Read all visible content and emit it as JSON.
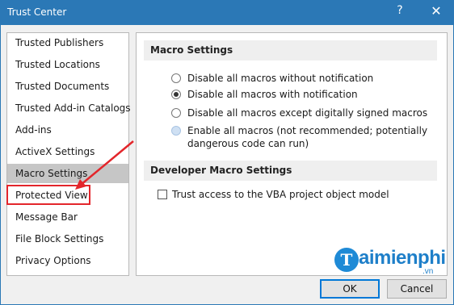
{
  "window": {
    "title": "Trust Center",
    "help_glyph": "?",
    "close_glyph": "✕"
  },
  "sidebar": {
    "items": [
      {
        "label": "Trusted Publishers"
      },
      {
        "label": "Trusted Locations"
      },
      {
        "label": "Trusted Documents"
      },
      {
        "label": "Trusted Add-in Catalogs"
      },
      {
        "label": "Add-ins"
      },
      {
        "label": "ActiveX Settings"
      },
      {
        "label": "Macro Settings"
      },
      {
        "label": "Protected View"
      },
      {
        "label": "Message Bar"
      },
      {
        "label": "File Block Settings"
      },
      {
        "label": "Privacy Options"
      }
    ],
    "selected": "Macro Settings"
  },
  "macro_settings": {
    "heading": "Macro Settings",
    "options": [
      {
        "label": "Disable all macros without notification",
        "checked": false
      },
      {
        "label": "Disable all macros with notification",
        "checked": true
      },
      {
        "label": "Disable all macros except digitally signed macros",
        "checked": false
      },
      {
        "label": "Enable all macros (not recommended; potentially",
        "label_line2": "dangerous code can run)",
        "checked": false
      }
    ]
  },
  "developer_settings": {
    "heading": "Developer Macro Settings",
    "vba_checkbox_label": "Trust access to the VBA project object model",
    "vba_checked": false
  },
  "buttons": {
    "ok": "OK",
    "cancel": "Cancel"
  },
  "watermark": {
    "initial": "T",
    "text": "aimienphi",
    "suffix": ".vn"
  },
  "colors": {
    "titlebar": "#2b78b6",
    "selected_item": "#c6c6c6",
    "annotation": "#e3262b",
    "watermark": "#1e7fc9"
  }
}
